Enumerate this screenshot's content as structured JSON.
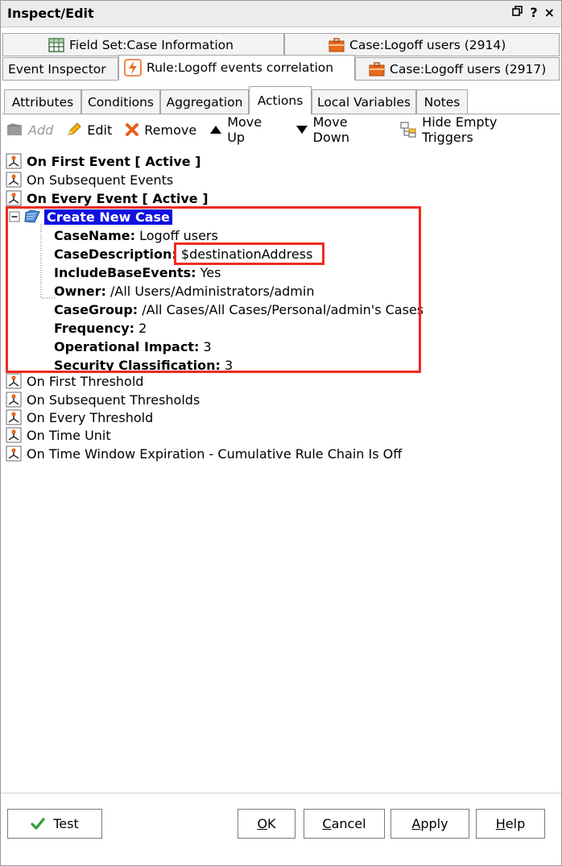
{
  "window": {
    "title": "Inspect/Edit",
    "controls": [
      "restore-icon",
      "?",
      "×"
    ]
  },
  "editor_tabs": {
    "row1": [
      {
        "label": "Field Set:Case Information",
        "icon": "grid-icon"
      },
      {
        "label": "Case:Logoff users (2914)",
        "icon": "briefcase-icon"
      }
    ],
    "row2": [
      {
        "label": "Event Inspector"
      },
      {
        "label": "Rule:Logoff events correlation",
        "icon": "rule-icon",
        "active": true
      },
      {
        "label": "Case:Logoff users (2917)",
        "icon": "briefcase-icon"
      }
    ]
  },
  "sub_tabs": [
    {
      "label": "Attributes"
    },
    {
      "label": "Conditions"
    },
    {
      "label": "Aggregation"
    },
    {
      "label": "Actions",
      "active": true
    },
    {
      "label": "Local Variables"
    },
    {
      "label": "Notes"
    }
  ],
  "toolbar": {
    "add": "Add",
    "edit": "Edit",
    "remove": "Remove",
    "move_up": "Move Up",
    "move_down": "Move Down",
    "hide_empty": "Hide Empty Triggers"
  },
  "tree": {
    "on_first_event": "On First Event [ Active ]",
    "on_subsequent_events": "On Subsequent Events",
    "on_every_event": "On Every Event [ Active ]",
    "create_new_case": "Create New Case",
    "props": [
      {
        "key": "CaseName:",
        "value": "Logoff users"
      },
      {
        "key": "CaseDescription:",
        "value": "$destinationAddress"
      },
      {
        "key": "IncludeBaseEvents:",
        "value": "Yes"
      },
      {
        "key": "Owner:",
        "value": "/All Users/Administrators/admin"
      },
      {
        "key": "CaseGroup:",
        "value": "/All Cases/All Cases/Personal/admin's Cases"
      },
      {
        "key": "Frequency:",
        "value": "2"
      },
      {
        "key": "Operational Impact:",
        "value": "3"
      },
      {
        "key": "Security Classification:",
        "value": "3"
      }
    ],
    "on_first_threshold": "On First Threshold",
    "on_subsequent_thresholds": "On Subsequent Thresholds",
    "on_every_threshold": "On Every Threshold",
    "on_time_unit": "On Time Unit",
    "on_time_window": "On Time Window Expiration - Cumulative Rule Chain Is Off"
  },
  "buttons": {
    "test": "Test",
    "ok_u": "O",
    "ok_rest": "K",
    "cancel_u": "C",
    "cancel_rest": "ancel",
    "apply_u": "A",
    "apply_rest": "pply",
    "help_u": "H",
    "help_rest": "elp"
  },
  "colors": {
    "highlight_box": "#ef2a1f",
    "selection": "#1010e0"
  }
}
